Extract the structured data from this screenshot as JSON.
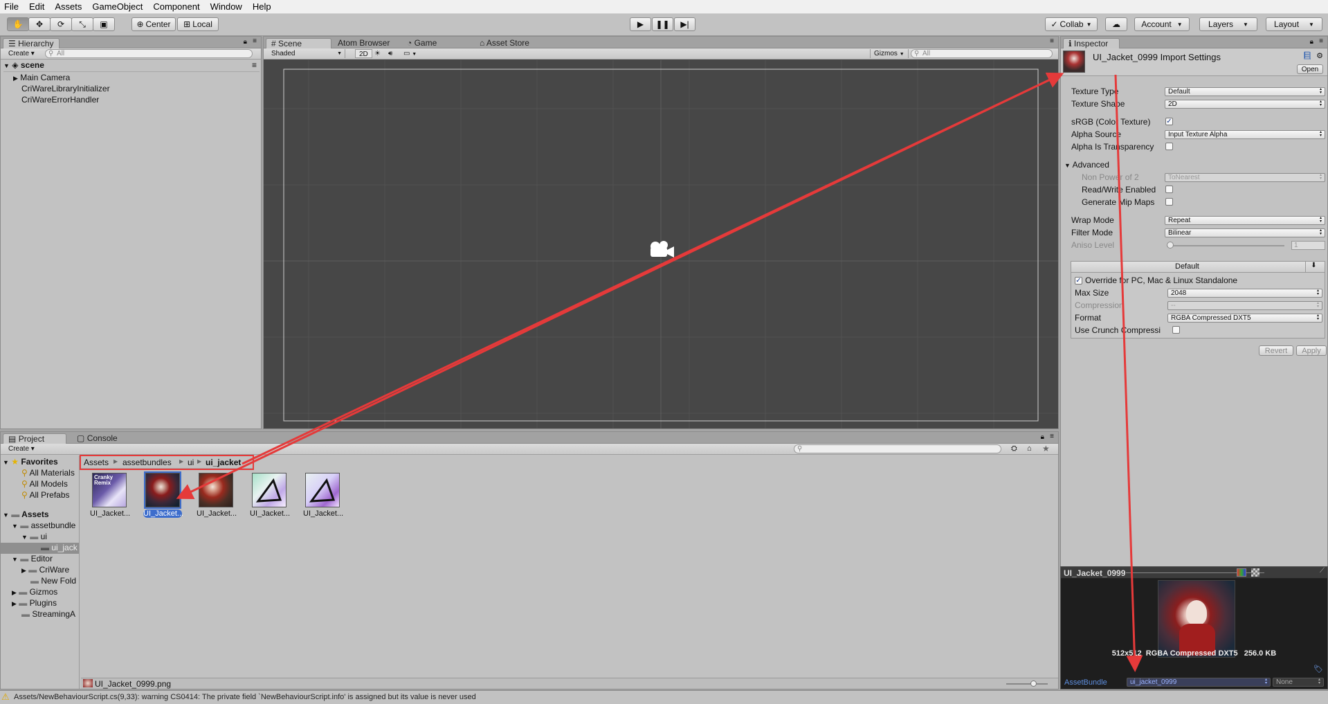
{
  "menu": [
    "File",
    "Edit",
    "Assets",
    "GameObject",
    "Component",
    "Window",
    "Help"
  ],
  "toolbar": {
    "center_label": "Center",
    "local_label": "Local",
    "collab_label": "Collab",
    "account_label": "Account",
    "layers_label": "Layers",
    "layout_label": "Layout"
  },
  "hierarchy": {
    "tab": "Hierarchy",
    "create_label": "Create",
    "search_placeholder": "All",
    "scene_name": "scene",
    "items": [
      "Main Camera",
      "CriWareLibraryInitializer",
      "CriWareErrorHandler"
    ]
  },
  "scene": {
    "tabs": [
      "Scene",
      "Atom Browser",
      "Game",
      "Asset Store"
    ],
    "shading_mode": "Shaded",
    "mode_2d_label": "2D",
    "gizmos_label": "Gizmos",
    "search_placeholder": "All"
  },
  "project": {
    "tabs": [
      "Project",
      "Console"
    ],
    "create_label": "Create",
    "favorites_label": "Favorites",
    "favorites": [
      "All Materials",
      "All Models",
      "All Prefabs"
    ],
    "assets_label": "Assets",
    "tree": [
      "assetbundle",
      "ui",
      "ui_jack",
      "Editor",
      "CriWare",
      "New Fold",
      "Gizmos",
      "Plugins",
      "StreamingA"
    ],
    "breadcrumb": [
      "Assets",
      "assetbundles",
      "ui",
      "ui_jacket"
    ],
    "thumb_labels": [
      "UI_Jacket...",
      "UI_Jacket...",
      "UI_Jacket...",
      "UI_Jacket...",
      "UI_Jacket..."
    ],
    "selected_file": "UI_Jacket_0999.png",
    "thumb_1_art_text": "Cranky Remix"
  },
  "inspector": {
    "tab": "Inspector",
    "title": "UI_Jacket_0999 Import Settings",
    "open_label": "Open",
    "texture_type_label": "Texture Type",
    "texture_type": "Default",
    "texture_shape_label": "Texture Shape",
    "texture_shape": "2D",
    "srgb_label": "sRGB (Color Texture)",
    "srgb_checked": true,
    "alpha_source_label": "Alpha Source",
    "alpha_source": "Input Texture Alpha",
    "alpha_transparency_label": "Alpha Is Transparency",
    "advanced_label": "Advanced",
    "npot_label": "Non Power of 2",
    "npot_value": "ToNearest",
    "rw_label": "Read/Write Enabled",
    "mip_label": "Generate Mip Maps",
    "wrap_label": "Wrap Mode",
    "wrap_value": "Repeat",
    "filter_label": "Filter Mode",
    "filter_value": "Bilinear",
    "aniso_label": "Aniso Level",
    "aniso_value": "1",
    "aniso_fraction": 0.0,
    "platform_default_label": "Default",
    "override_label": "Override for PC, Mac & Linux Standalone",
    "override_checked": true,
    "max_size_label": "Max Size",
    "max_size": "2048",
    "compression_label": "Compression",
    "compression_value": "--",
    "format_label": "Format",
    "format_value": "RGBA Compressed DXT5",
    "crunch_label": "Use Crunch Compressi",
    "revert_label": "Revert",
    "apply_label": "Apply"
  },
  "preview": {
    "title": "UI_Jacket_0999",
    "info": "512x512  RGBA Compressed DXT5   256.0 KB",
    "assetbundle_label": "AssetBundle",
    "assetbundle_value": "ui_jacket_0999",
    "variant_value": "None"
  },
  "status": {
    "message": "Assets/NewBehaviourScript.cs(9,33): warning CS0414: The private field `NewBehaviourScript.info' is assigned but its value is never used"
  },
  "colors": {
    "annotation_red": "#e53a3a",
    "scene_bg": "#474747",
    "selection_blue": "#3d6dcc",
    "panel_bg": "#c2c2c2"
  }
}
